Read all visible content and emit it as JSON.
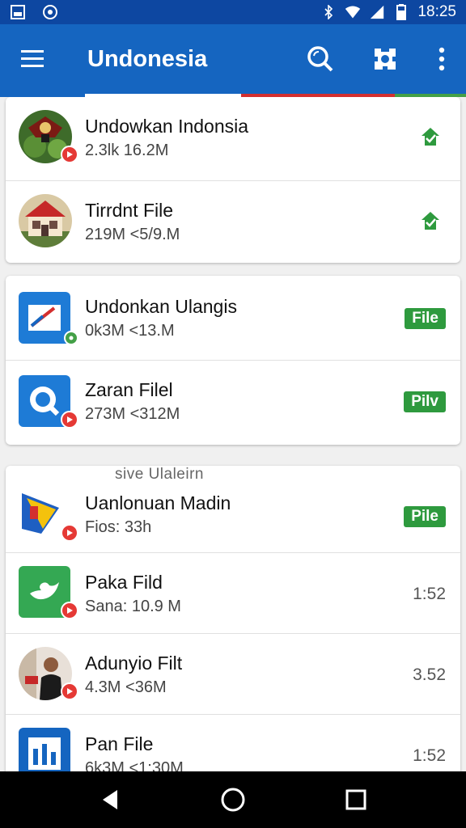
{
  "status_bar": {
    "time": "18:25",
    "icons": [
      "photo-icon",
      "notification-icon",
      "bluetooth-icon",
      "wifi-icon",
      "signal-icon",
      "battery-icon"
    ]
  },
  "app_bar": {
    "title": "Undonesia",
    "actions": [
      "search-icon",
      "settings-icon",
      "more-vert-icon"
    ],
    "color": "#1565c0"
  },
  "cards": [
    {
      "items": [
        {
          "title": "Undowkan Indonsia",
          "subtitle": "2.3lk  16.2M",
          "trailing_icon": "download-check-icon",
          "badge": "red"
        },
        {
          "title": "Tirrdnt File",
          "subtitle": "219M  <5/9.M",
          "trailing_icon": "download-check-icon",
          "badge": "none"
        }
      ]
    },
    {
      "items": [
        {
          "title": "Undonkan Ulangis",
          "subtitle": "0k3M  <13.M",
          "trailing_pill": "File",
          "badge": "green"
        },
        {
          "title": "Zaran Filel",
          "subtitle": "273M  <312M",
          "trailing_pill": "Pilv",
          "badge": "red"
        }
      ]
    },
    {
      "section_label": "sive Ulaleirn",
      "items": [
        {
          "title": "Uanlonuan Madin",
          "subtitle": "Fios:  33h",
          "trailing_pill": "Pile",
          "badge": "red"
        },
        {
          "title": "Paka Fild",
          "subtitle": "Sana:  10.9 M",
          "trailing_time": "1:52",
          "badge": "red"
        },
        {
          "title": "Adunyio Filt",
          "subtitle": "4.3M  <36M",
          "trailing_time": "3.52",
          "badge": "red"
        },
        {
          "title": "Pan File",
          "subtitle": "6k3M  <1:30M",
          "trailing_time": "1:52",
          "badge": "none"
        }
      ]
    }
  ],
  "nav_bar": {
    "buttons": [
      "back-icon",
      "home-icon",
      "recents-icon"
    ]
  },
  "colors": {
    "primary": "#1565c0",
    "accent_green": "#2e9a3e",
    "badge_red": "#e53935"
  }
}
